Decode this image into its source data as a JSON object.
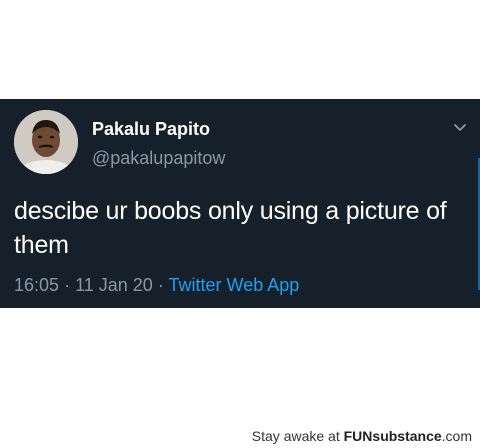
{
  "tweet": {
    "display_name": "Pakalu Papito",
    "handle": "@pakalupapitow",
    "text": "descibe ur boobs only using a picture of them",
    "time": "16:05",
    "separator": "·",
    "date": "11 Jan 20",
    "source": "Twitter Web App",
    "menu_icon": "chevron-down-icon",
    "avatar_icon": "avatar-photo"
  },
  "watermark": {
    "prefix": "Stay awake at",
    "brand_fun": "FUN",
    "brand_rest": "substance",
    "suffix": ".com"
  },
  "colors": {
    "card_background": "#15202b",
    "name_text": "#ffffff",
    "secondary_text": "#8899a6",
    "link_accent": "#1da1f2",
    "page_background": "#ffffff"
  }
}
